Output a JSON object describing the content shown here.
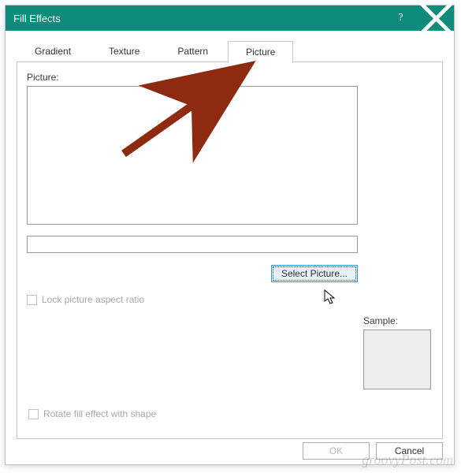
{
  "dialog": {
    "title": "Fill Effects"
  },
  "tabs": {
    "gradient": "Gradient",
    "texture": "Texture",
    "pattern": "Pattern",
    "picture": "Picture"
  },
  "labels": {
    "picture": "Picture:",
    "sample": "Sample:"
  },
  "buttons": {
    "select_picture": "Select Picture...",
    "ok": "OK",
    "cancel": "Cancel"
  },
  "checkboxes": {
    "lock_aspect": "Lock picture aspect ratio",
    "rotate_fill": "Rotate fill effect with shape"
  },
  "watermark": "groovyPost.com"
}
